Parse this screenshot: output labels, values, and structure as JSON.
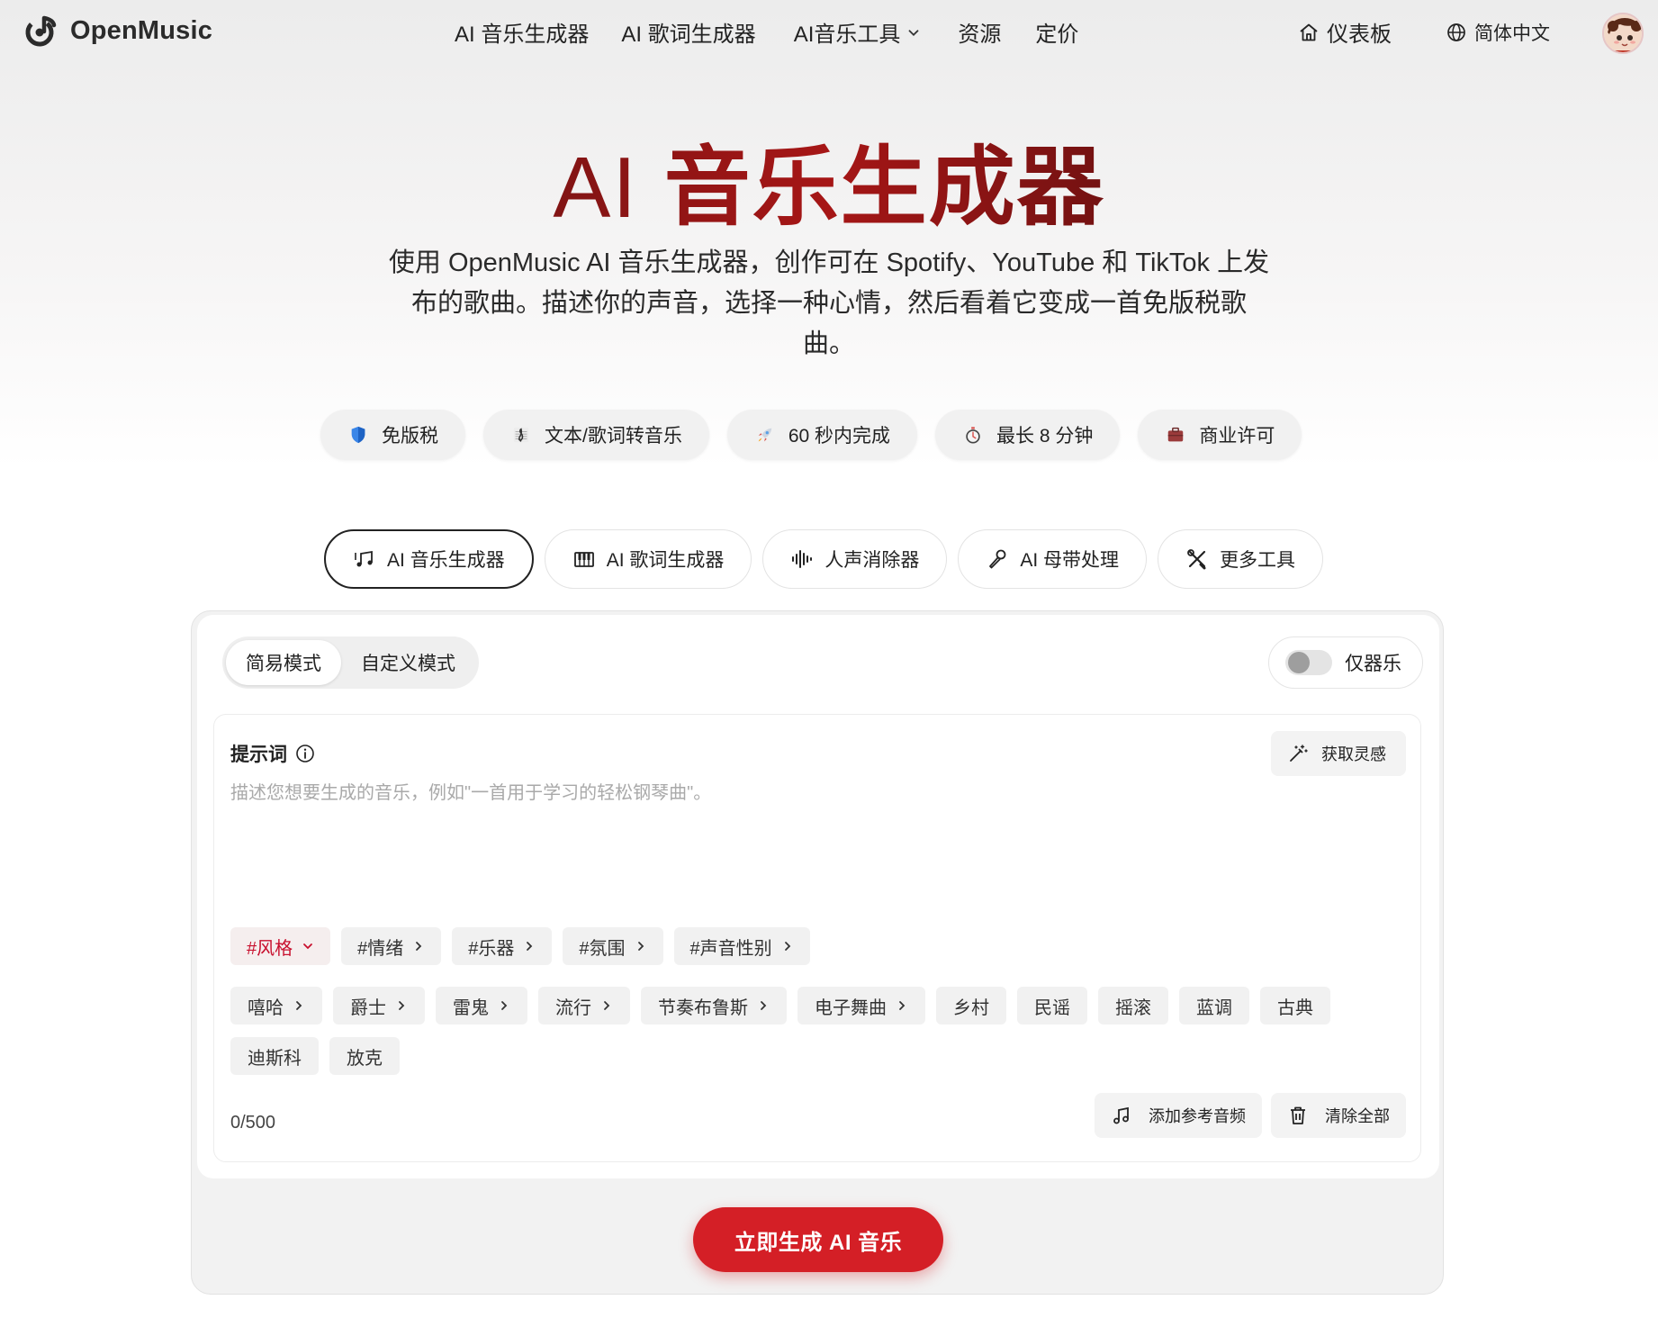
{
  "brand": {
    "name": "OpenMusic"
  },
  "nav": {
    "items": [
      {
        "label": "AI 音乐生成器"
      },
      {
        "label": "AI 歌词生成器"
      },
      {
        "label": "AI音乐工具"
      },
      {
        "label": "资源"
      },
      {
        "label": "定价"
      }
    ],
    "dashboard": "仪表板",
    "language": "简体中文"
  },
  "hero": {
    "title_ai": "AI",
    "title_rest": "音乐生成器",
    "description": "使用 OpenMusic AI 音乐生成器，创作可在 Spotify、YouTube 和 TikTok 上发布的歌曲。描述你的声音，选择一种心情，然后看着它变成一首免版税歌曲。"
  },
  "features": [
    {
      "label": "免版税",
      "icon": "shield-icon"
    },
    {
      "label": "文本/歌词转音乐",
      "icon": "music-score-icon"
    },
    {
      "label": "60 秒内完成",
      "icon": "rocket-icon"
    },
    {
      "label": "最长 8 分钟",
      "icon": "stopwatch-icon"
    },
    {
      "label": "商业许可",
      "icon": "briefcase-icon"
    }
  ],
  "tools": [
    {
      "label": "AI 音乐生成器",
      "icon": "music-notes-icon",
      "active": true
    },
    {
      "label": "AI 歌词生成器",
      "icon": "piano-icon",
      "active": false
    },
    {
      "label": "人声消除器",
      "icon": "waveform-icon",
      "active": false
    },
    {
      "label": "AI 母带处理",
      "icon": "microphone-icon",
      "active": false
    },
    {
      "label": "更多工具",
      "icon": "tools-icon",
      "active": false
    }
  ],
  "card": {
    "modes": {
      "simple": "简易模式",
      "custom": "自定义模式"
    },
    "instrumental": "仅器乐",
    "prompt": {
      "label": "提示词",
      "inspire": "获取灵感",
      "placeholder": "描述您想要生成的音乐，例如\"一首用于学习的轻松钢琴曲\"。",
      "value": ""
    },
    "tag_categories": [
      "#风格",
      "#情绪",
      "#乐器",
      "#氛围",
      "#声音性别"
    ],
    "genres": [
      {
        "label": "嘻哈",
        "more": true
      },
      {
        "label": "爵士",
        "more": true
      },
      {
        "label": "雷鬼",
        "more": true
      },
      {
        "label": "流行",
        "more": true
      },
      {
        "label": "节奏布鲁斯",
        "more": true
      },
      {
        "label": "电子舞曲",
        "more": true
      },
      {
        "label": "乡村",
        "more": false
      },
      {
        "label": "民谣",
        "more": false
      },
      {
        "label": "摇滚",
        "more": false
      },
      {
        "label": "蓝调",
        "more": false
      },
      {
        "label": "古典",
        "more": false
      },
      {
        "label": "迪斯科",
        "more": false
      },
      {
        "label": "放克",
        "more": false
      }
    ],
    "counter": "0/500",
    "add_reference": "添加参考音频",
    "clear_all": "清除全部",
    "generate": "立即生成 AI 音乐"
  },
  "colors": {
    "accent": "#d41f26",
    "active_tag": "#c8102e"
  }
}
